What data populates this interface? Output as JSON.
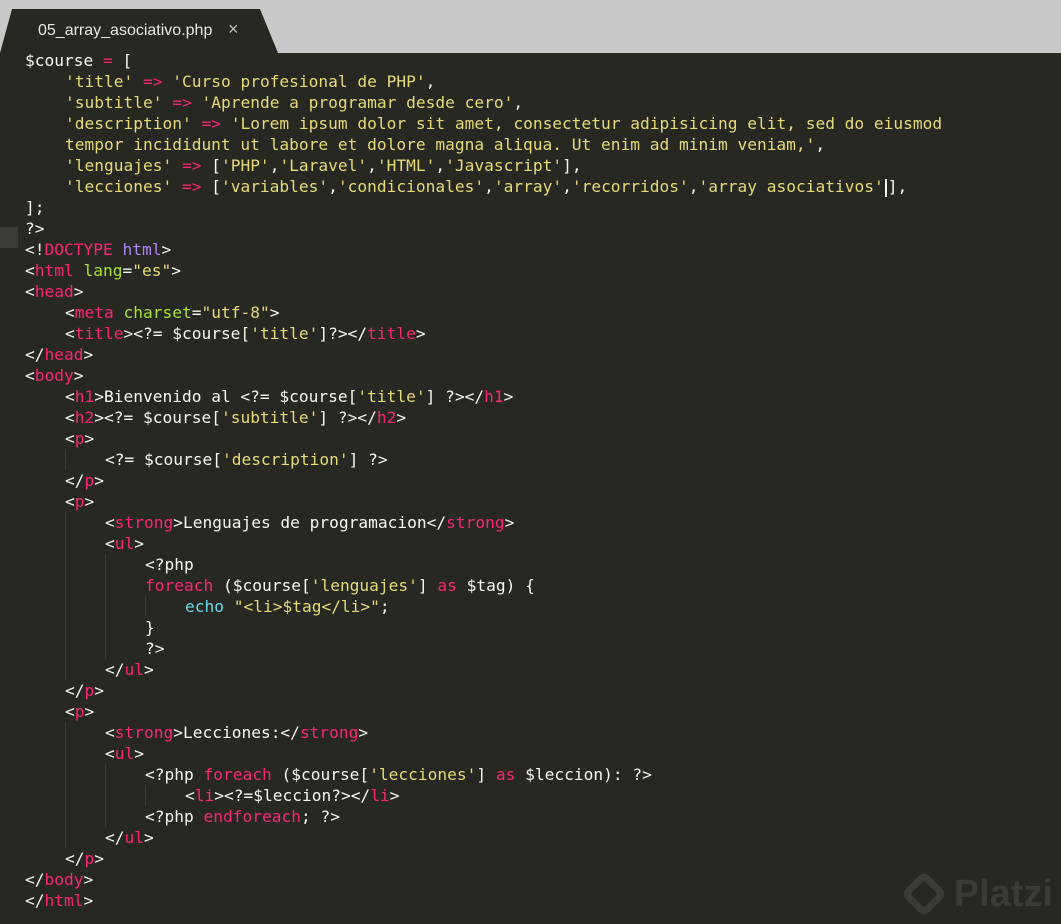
{
  "tab": {
    "filename": "05_array_asociativo.php",
    "close": "×"
  },
  "colors": {
    "background": "#272822",
    "default": "#f8f8f2",
    "keyword": "#f92672",
    "string": "#e6db74",
    "attribute": "#a6e22e",
    "builtin": "#66d9ef",
    "tag": "#f92672",
    "doctype": "#ae81ff"
  },
  "code": [
    [
      {
        "t": "$course "
      },
      {
        "t": "=",
        "c": "keyword"
      },
      {
        "t": " ["
      }
    ],
    [
      {
        "t": "'title'",
        "c": "string"
      },
      {
        "t": " "
      },
      {
        "t": "=>",
        "c": "keyword"
      },
      {
        "t": " "
      },
      {
        "t": "'Curso profesional de PHP'",
        "c": "string"
      },
      {
        "t": ","
      }
    ],
    [
      {
        "t": "'subtitle'",
        "c": "string"
      },
      {
        "t": " "
      },
      {
        "t": "=>",
        "c": "keyword"
      },
      {
        "t": " "
      },
      {
        "t": "'Aprende a programar desde cero'",
        "c": "string"
      },
      {
        "t": ","
      }
    ],
    [
      {
        "t": "'description'",
        "c": "string"
      },
      {
        "t": " "
      },
      {
        "t": "=>",
        "c": "keyword"
      },
      {
        "t": " "
      },
      {
        "t": "'Lorem ipsum dolor sit amet, consectetur adipisicing elit, sed do eiusmod",
        "c": "string"
      }
    ],
    [
      {
        "t": "tempor incididunt ut labore et dolore magna aliqua. Ut enim ad minim veniam,'",
        "c": "string"
      },
      {
        "t": ","
      }
    ],
    [
      {
        "t": "'lenguajes'",
        "c": "string"
      },
      {
        "t": " "
      },
      {
        "t": "=>",
        "c": "keyword"
      },
      {
        "t": " ["
      },
      {
        "t": "'PHP'",
        "c": "string"
      },
      {
        "t": ","
      },
      {
        "t": "'Laravel'",
        "c": "string"
      },
      {
        "t": ","
      },
      {
        "t": "'HTML'",
        "c": "string"
      },
      {
        "t": ","
      },
      {
        "t": "'Javascript'",
        "c": "string"
      },
      {
        "t": "],"
      }
    ],
    [
      {
        "t": "'lecciones'",
        "c": "string"
      },
      {
        "t": " "
      },
      {
        "t": "=>",
        "c": "keyword"
      },
      {
        "t": " ["
      },
      {
        "t": "'variables'",
        "c": "string"
      },
      {
        "t": ","
      },
      {
        "t": "'condicionales'",
        "c": "string"
      },
      {
        "t": ","
      },
      {
        "t": "'array'",
        "c": "string"
      },
      {
        "t": ","
      },
      {
        "t": "'recorridos'",
        "c": "string"
      },
      {
        "t": ","
      },
      {
        "t": "'array asociativos'",
        "c": "string"
      },
      {
        "cursor": true
      },
      {
        "t": "],"
      }
    ],
    [
      {
        "t": "];"
      }
    ],
    [
      {
        "t": "?>"
      }
    ],
    [
      {
        "t": "<!"
      },
      {
        "t": "DOCTYPE",
        "c": "keyword"
      },
      {
        "t": " "
      },
      {
        "t": "html",
        "c": "doctype"
      },
      {
        "t": ">"
      }
    ],
    [
      {
        "t": "<"
      },
      {
        "t": "html",
        "c": "tag"
      },
      {
        "t": " "
      },
      {
        "t": "lang",
        "c": "attribute"
      },
      {
        "t": "="
      },
      {
        "t": "\"es\"",
        "c": "string"
      },
      {
        "t": ">"
      }
    ],
    [
      {
        "t": "<"
      },
      {
        "t": "head",
        "c": "tag"
      },
      {
        "t": ">"
      }
    ],
    [
      {
        "t": "<"
      },
      {
        "t": "meta",
        "c": "tag"
      },
      {
        "t": " "
      },
      {
        "t": "charset",
        "c": "attribute"
      },
      {
        "t": "="
      },
      {
        "t": "\"utf-8\"",
        "c": "string"
      },
      {
        "t": ">"
      }
    ],
    [
      {
        "t": "<"
      },
      {
        "t": "title",
        "c": "tag"
      },
      {
        "t": "><?= $course["
      },
      {
        "t": "'title'",
        "c": "string"
      },
      {
        "t": "]?></"
      },
      {
        "t": "title",
        "c": "tag"
      },
      {
        "t": ">"
      }
    ],
    [
      {
        "t": "</"
      },
      {
        "t": "head",
        "c": "tag"
      },
      {
        "t": ">"
      }
    ],
    [
      {
        "t": "<"
      },
      {
        "t": "body",
        "c": "tag"
      },
      {
        "t": ">"
      }
    ],
    [
      {
        "t": "<"
      },
      {
        "t": "h1",
        "c": "tag"
      },
      {
        "t": ">Bienvenido al <?= $course["
      },
      {
        "t": "'title'",
        "c": "string"
      },
      {
        "t": "] ?></"
      },
      {
        "t": "h1",
        "c": "tag"
      },
      {
        "t": ">"
      }
    ],
    [
      {
        "t": "<"
      },
      {
        "t": "h2",
        "c": "tag"
      },
      {
        "t": "><?= $course["
      },
      {
        "t": "'subtitle'",
        "c": "string"
      },
      {
        "t": "] ?></"
      },
      {
        "t": "h2",
        "c": "tag"
      },
      {
        "t": ">"
      }
    ],
    [
      {
        "t": "<"
      },
      {
        "t": "p",
        "c": "tag"
      },
      {
        "t": ">"
      }
    ],
    [
      {
        "t": "<?= $course["
      },
      {
        "t": "'description'",
        "c": "string"
      },
      {
        "t": "] ?>"
      }
    ],
    [
      {
        "t": "</"
      },
      {
        "t": "p",
        "c": "tag"
      },
      {
        "t": ">"
      }
    ],
    [
      {
        "t": "<"
      },
      {
        "t": "p",
        "c": "tag"
      },
      {
        "t": ">"
      }
    ],
    [
      {
        "t": "<"
      },
      {
        "t": "strong",
        "c": "tag"
      },
      {
        "t": ">Lenguajes de programacion</"
      },
      {
        "t": "strong",
        "c": "tag"
      },
      {
        "t": ">"
      }
    ],
    [
      {
        "t": "<"
      },
      {
        "t": "ul",
        "c": "tag"
      },
      {
        "t": ">"
      }
    ],
    [
      {
        "t": "<?php"
      }
    ],
    [
      {
        "t": "foreach",
        "c": "keyword"
      },
      {
        "t": " ($course["
      },
      {
        "t": "'lenguajes'",
        "c": "string"
      },
      {
        "t": "] "
      },
      {
        "t": "as",
        "c": "keyword"
      },
      {
        "t": " $tag) {"
      }
    ],
    [
      {
        "t": "echo",
        "c": "builtin"
      },
      {
        "t": " "
      },
      {
        "t": "\"<li>$tag</li>\"",
        "c": "string"
      },
      {
        "t": ";"
      }
    ],
    [
      {
        "t": "}"
      }
    ],
    [
      {
        "t": "?>"
      }
    ],
    [
      {
        "t": "</"
      },
      {
        "t": "ul",
        "c": "tag"
      },
      {
        "t": ">"
      }
    ],
    [
      {
        "t": "</"
      },
      {
        "t": "p",
        "c": "tag"
      },
      {
        "t": ">"
      }
    ],
    [
      {
        "t": "<"
      },
      {
        "t": "p",
        "c": "tag"
      },
      {
        "t": ">"
      }
    ],
    [
      {
        "t": "<"
      },
      {
        "t": "strong",
        "c": "tag"
      },
      {
        "t": ">Lecciones:</"
      },
      {
        "t": "strong",
        "c": "tag"
      },
      {
        "t": ">"
      }
    ],
    [
      {
        "t": "<"
      },
      {
        "t": "ul",
        "c": "tag"
      },
      {
        "t": ">"
      }
    ],
    [
      {
        "t": "<?php "
      },
      {
        "t": "foreach",
        "c": "keyword"
      },
      {
        "t": " ($course["
      },
      {
        "t": "'lecciones'",
        "c": "string"
      },
      {
        "t": "] "
      },
      {
        "t": "as",
        "c": "keyword"
      },
      {
        "t": " $leccion): ?>"
      }
    ],
    [
      {
        "t": "<"
      },
      {
        "t": "li",
        "c": "tag"
      },
      {
        "t": "><?=$leccion?></"
      },
      {
        "t": "li",
        "c": "tag"
      },
      {
        "t": ">"
      }
    ],
    [
      {
        "t": "<?php "
      },
      {
        "t": "endforeach",
        "c": "keyword"
      },
      {
        "t": "; ?>"
      }
    ],
    [
      {
        "t": "</"
      },
      {
        "t": "ul",
        "c": "tag"
      },
      {
        "t": ">"
      }
    ],
    [
      {
        "t": "</"
      },
      {
        "t": "p",
        "c": "tag"
      },
      {
        "t": ">"
      }
    ],
    [
      {
        "t": "</"
      },
      {
        "t": "body",
        "c": "tag"
      },
      {
        "t": ">"
      }
    ],
    [
      {
        "t": "</"
      },
      {
        "t": "html",
        "c": "tag"
      },
      {
        "t": ">"
      }
    ]
  ],
  "watermark": {
    "text": "Platzi"
  }
}
